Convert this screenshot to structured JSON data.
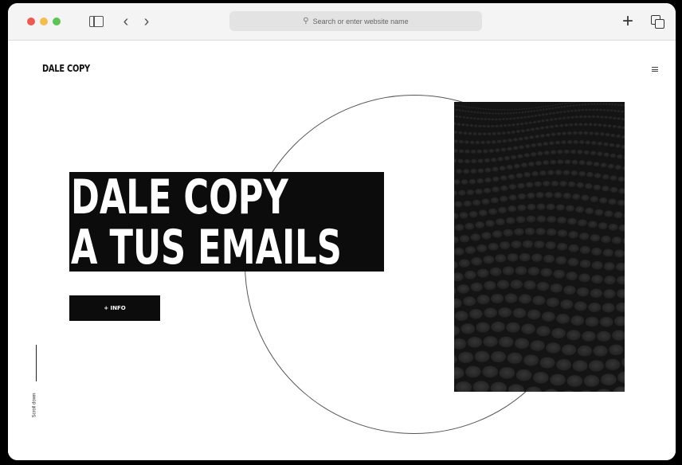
{
  "browser": {
    "address_placeholder": "Search or enter website name"
  },
  "site": {
    "logo": "DALE COPY",
    "hero_line1": "DALE COPY",
    "hero_line2": "A TUS EMAILS",
    "cta_label": "+ INFO",
    "scroll_label": "Scroll down"
  }
}
